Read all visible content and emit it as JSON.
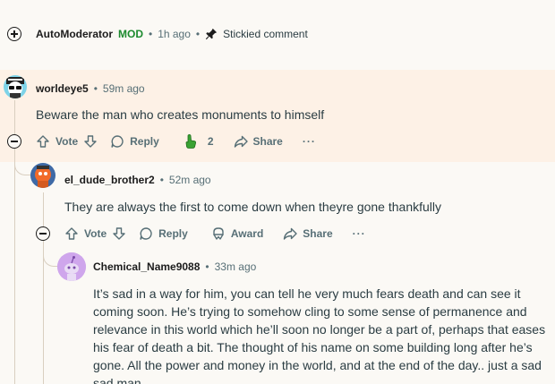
{
  "stickied": {
    "username": "AutoModerator",
    "mod_badge": "MOD",
    "sep1": "•",
    "time": "1h ago",
    "sep2": "•",
    "stickied_label": "Stickied comment"
  },
  "comment1": {
    "username": "worldeye5",
    "sep": "•",
    "time": "59m ago",
    "body": "Beware the man who creates monuments to himself",
    "vote_label": "Vote",
    "reply_label": "Reply",
    "award_count": "2",
    "share_label": "Share",
    "more_label": "···"
  },
  "comment2": {
    "username": "el_dude_brother2",
    "sep": "•",
    "time": "52m ago",
    "body": "They are always the first to come down when theyre gone thankfully",
    "vote_label": "Vote",
    "reply_label": "Reply",
    "award_label": "Award",
    "share_label": "Share",
    "more_label": "···"
  },
  "comment3": {
    "username": "Chemical_Name9088",
    "sep": "•",
    "time": "33m ago",
    "body_lines": [
      "It’s sad in a way for him, you can tell he very much fears death and can see it",
      "coming soon.  He’s trying to somehow cling to some sense of permanence and",
      "relevance in this world which he’ll soon no longer be a part of, perhaps that eases",
      "his fear of death a bit. The thought of his name on some building long after he’s",
      "gone. All the power and money in the world, and at the end of the day.. just a sad",
      "sad man."
    ]
  },
  "colors": {
    "mod_green": "#1c8a2e",
    "highlight_bg": "#fdf1e6",
    "page_bg": "#fbf9f5",
    "meta_gray": "#576f76"
  }
}
